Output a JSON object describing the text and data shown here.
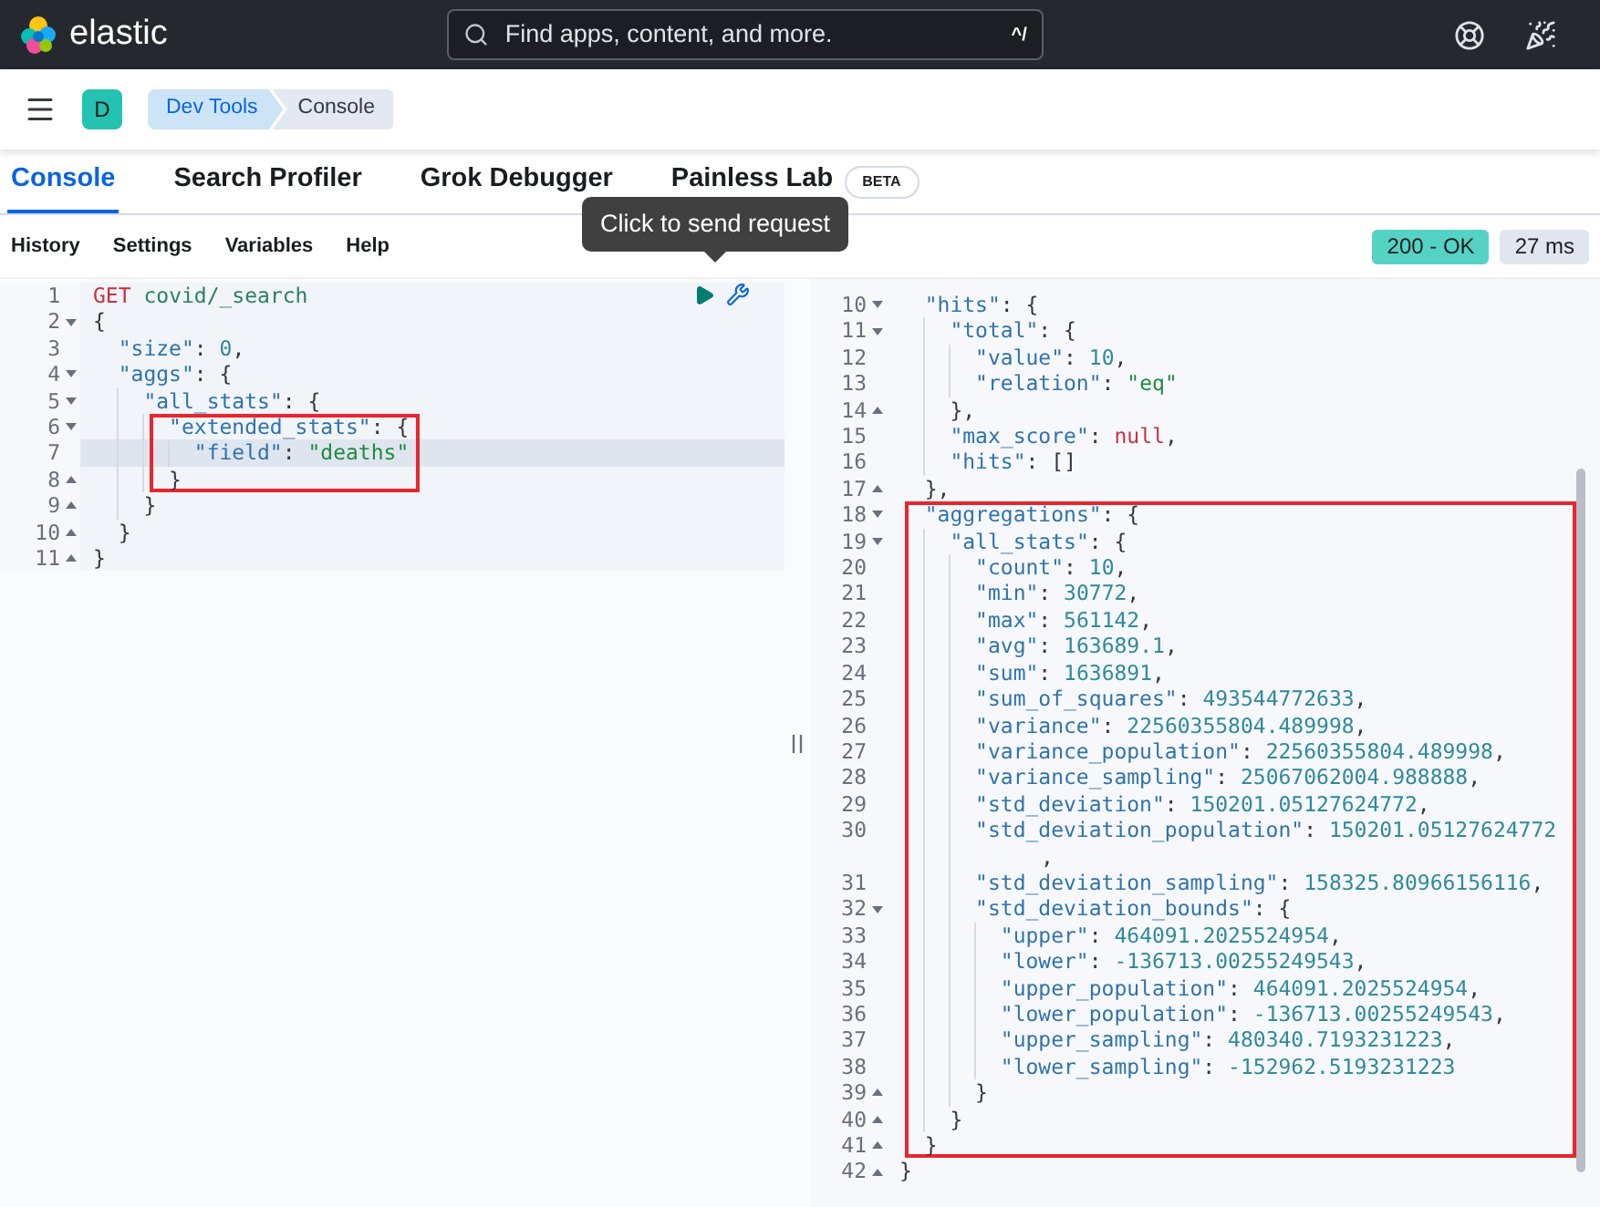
{
  "header": {
    "brand": "elastic",
    "search": {
      "placeholder": "Find apps, content, and more.",
      "shortcut": "^/"
    }
  },
  "breadcrumb": {
    "avatar": "D",
    "items": [
      {
        "label": "Dev Tools",
        "selected": false
      },
      {
        "label": "Console",
        "selected": true
      }
    ]
  },
  "tabs": [
    {
      "label": "Console",
      "selected": true
    },
    {
      "label": "Search Profiler",
      "selected": false
    },
    {
      "label": "Grok Debugger",
      "selected": false
    },
    {
      "label": "Painless Lab",
      "selected": false,
      "badge": "BETA"
    }
  ],
  "toolbar": {
    "items": [
      "History",
      "Settings",
      "Variables",
      "Help"
    ],
    "status": "200 - OK",
    "time": "27 ms"
  },
  "tooltip": "Click to send request",
  "request": {
    "lines": [
      {
        "number": "1",
        "kind": "plain",
        "text": "GET covid/_search",
        "active": false,
        "boxed": false
      },
      {
        "number": "2",
        "kind": "open",
        "text": "{",
        "active": false,
        "boxed": false
      },
      {
        "number": "3",
        "kind": "plain",
        "text": "  \"size\": 0,",
        "active": false,
        "boxed": false
      },
      {
        "number": "4",
        "kind": "open",
        "text": "  \"aggs\": {",
        "active": false,
        "boxed": false
      },
      {
        "number": "5",
        "kind": "open",
        "text": "    \"all_stats\": {",
        "active": false,
        "boxed": false
      },
      {
        "number": "6",
        "kind": "open",
        "text": "      \"extended_stats\": {",
        "active": false,
        "boxed": true
      },
      {
        "number": "7",
        "kind": "plain",
        "text": "        \"field\": \"deaths\"",
        "active": true,
        "boxed": true
      },
      {
        "number": "8",
        "kind": "close",
        "text": "      }",
        "active": false,
        "boxed": true
      },
      {
        "number": "9",
        "kind": "close",
        "text": "    }",
        "active": false,
        "boxed": false
      },
      {
        "number": "10",
        "kind": "close",
        "text": "  }",
        "active": false,
        "boxed": false
      },
      {
        "number": "11",
        "kind": "close",
        "text": "}",
        "active": false,
        "boxed": false
      }
    ]
  },
  "response": {
    "lines": [
      {
        "number": "10",
        "kind": "open",
        "text": "  \"hits\": {",
        "boxed": false
      },
      {
        "number": "11",
        "kind": "open",
        "text": "    \"total\": {",
        "boxed": false
      },
      {
        "number": "12",
        "kind": "plain",
        "text": "      \"value\": 10,",
        "boxed": false
      },
      {
        "number": "13",
        "kind": "plain",
        "text": "      \"relation\": \"eq\"",
        "boxed": false
      },
      {
        "number": "14",
        "kind": "close",
        "text": "    },",
        "boxed": false
      },
      {
        "number": "15",
        "kind": "plain",
        "text": "    \"max_score\": null,",
        "boxed": false
      },
      {
        "number": "16",
        "kind": "plain",
        "text": "    \"hits\": []",
        "boxed": false
      },
      {
        "number": "17",
        "kind": "close",
        "text": "  },",
        "boxed": false
      },
      {
        "number": "18",
        "kind": "open",
        "text": "  \"aggregations\": {",
        "boxed": true
      },
      {
        "number": "19",
        "kind": "open",
        "text": "    \"all_stats\": {",
        "boxed": true
      },
      {
        "number": "20",
        "kind": "plain",
        "text": "      \"count\": 10,",
        "boxed": true
      },
      {
        "number": "21",
        "kind": "plain",
        "text": "      \"min\": 30772,",
        "boxed": true
      },
      {
        "number": "22",
        "kind": "plain",
        "text": "      \"max\": 561142,",
        "boxed": true
      },
      {
        "number": "23",
        "kind": "plain",
        "text": "      \"avg\": 163689.1,",
        "boxed": true
      },
      {
        "number": "24",
        "kind": "plain",
        "text": "      \"sum\": 1636891,",
        "boxed": true
      },
      {
        "number": "25",
        "kind": "plain",
        "text": "      \"sum_of_squares\": 493544772633,",
        "boxed": true
      },
      {
        "number": "26",
        "kind": "plain",
        "text": "      \"variance\": 22560355804.489998,",
        "boxed": true
      },
      {
        "number": "27",
        "kind": "plain",
        "text": "      \"variance_population\": 22560355804.489998,",
        "boxed": true
      },
      {
        "number": "28",
        "kind": "plain",
        "text": "      \"variance_sampling\": 25067062004.988888,",
        "boxed": true
      },
      {
        "number": "29",
        "kind": "plain",
        "text": "      \"std_deviation\": 150201.05127624772,",
        "boxed": true
      },
      {
        "number": "30",
        "kind": "plain",
        "text": "      \"std_deviation_population\": 150201.05127624772",
        "wrap": ",",
        "boxed": true
      },
      {
        "number": "31",
        "kind": "plain",
        "text": "      \"std_deviation_sampling\": 158325.80966156116,",
        "boxed": true
      },
      {
        "number": "32",
        "kind": "open",
        "text": "      \"std_deviation_bounds\": {",
        "boxed": true
      },
      {
        "number": "33",
        "kind": "plain",
        "text": "        \"upper\": 464091.2025524954,",
        "boxed": true
      },
      {
        "number": "34",
        "kind": "plain",
        "text": "        \"lower\": -136713.00255249543,",
        "boxed": true
      },
      {
        "number": "35",
        "kind": "plain",
        "text": "        \"upper_population\": 464091.2025524954,",
        "boxed": true
      },
      {
        "number": "36",
        "kind": "plain",
        "text": "        \"lower_population\": -136713.00255249543,",
        "boxed": true
      },
      {
        "number": "37",
        "kind": "plain",
        "text": "        \"upper_sampling\": 480340.7193231223,",
        "boxed": true
      },
      {
        "number": "38",
        "kind": "plain",
        "text": "        \"lower_sampling\": -152962.5193231223",
        "boxed": true
      },
      {
        "number": "39",
        "kind": "close",
        "text": "      }",
        "boxed": true
      },
      {
        "number": "40",
        "kind": "close",
        "text": "    }",
        "boxed": true
      },
      {
        "number": "41",
        "kind": "close",
        "text": "  }",
        "boxed": true
      },
      {
        "number": "42",
        "kind": "close",
        "text": "}",
        "boxed": false
      }
    ]
  }
}
